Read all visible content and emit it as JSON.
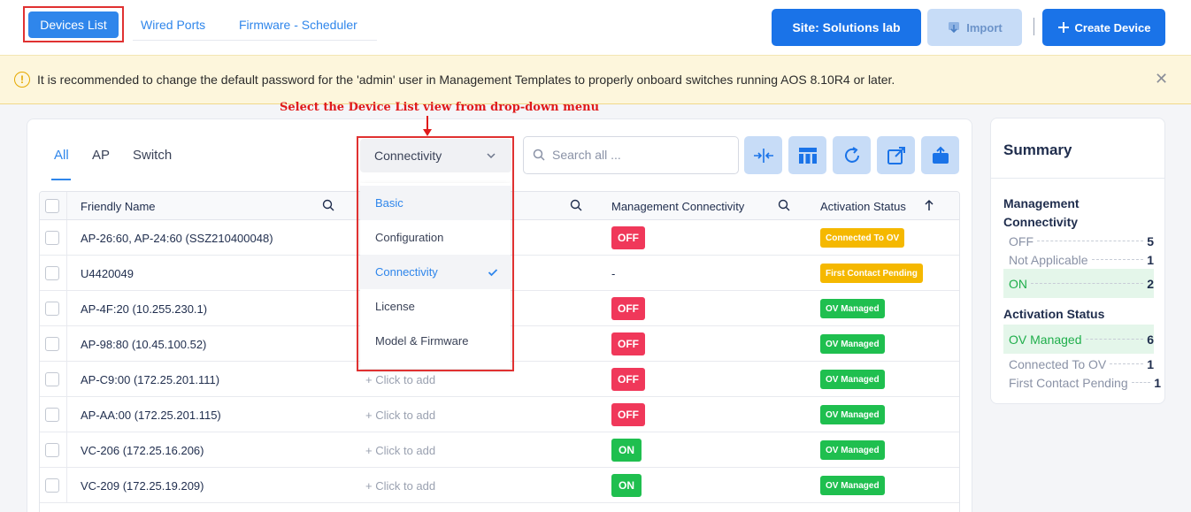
{
  "top_tabs": {
    "devices_list": "Devices List",
    "wired_ports": "Wired Ports",
    "firmware_scheduler": "Firmware - Scheduler"
  },
  "header_buttons": {
    "site": "Site:  Solutions lab",
    "import": "Import",
    "separator": "|",
    "create_device": "Create Device"
  },
  "banner": {
    "icon": "warning-circle-icon",
    "text": "It is recommended to change the default password for the 'admin' user in Management Templates to properly onboard switches running AOS 8.10R4 or later."
  },
  "annotation": "Select the Device List view from drop-down menu",
  "filter_tabs": [
    "All",
    "AP",
    "Switch"
  ],
  "view_select": {
    "selected": "Connectivity",
    "options": [
      "Basic",
      "Configuration",
      "Connectivity",
      "License",
      "Model & Firmware"
    ]
  },
  "search": {
    "placeholder": "Search all ..."
  },
  "table": {
    "headers": {
      "friendly_name": "Friendly Name",
      "management_connectivity": "Management Connectivity",
      "activation_status": "Activation Status"
    },
    "rows": [
      {
        "name": "AP-26:60, AP-24:60 (SSZ210400048)",
        "col2": "",
        "mgmt": "OFF",
        "activation": "Connected To OV"
      },
      {
        "name": "U4420049",
        "col2": "",
        "mgmt": "-",
        "activation": "First Contact Pending"
      },
      {
        "name": "AP-4F:20 (10.255.230.1)",
        "col2": "",
        "mgmt": "OFF",
        "activation": "OV Managed"
      },
      {
        "name": "AP-98:80 (10.45.100.52)",
        "col2": "",
        "mgmt": "OFF",
        "activation": "OV Managed"
      },
      {
        "name": "AP-C9:00 (172.25.201.111)",
        "col2": "+  Click to add",
        "mgmt": "OFF",
        "activation": "OV Managed"
      },
      {
        "name": "AP-AA:00 (172.25.201.115)",
        "col2": "+  Click to add",
        "mgmt": "OFF",
        "activation": "OV Managed"
      },
      {
        "name": "VC-206 (172.25.16.206)",
        "col2": "+  Click to add",
        "mgmt": "ON",
        "activation": "OV Managed"
      },
      {
        "name": "VC-209 (172.25.19.209)",
        "col2": "+  Click to add",
        "mgmt": "ON",
        "activation": "OV Managed"
      }
    ]
  },
  "summary": {
    "title": "Summary",
    "mgmt_heading_line1": "Management",
    "mgmt_heading_line2": "Connectivity",
    "mgmt": [
      {
        "label": "OFF",
        "count": "5"
      },
      {
        "label": "Not Applicable",
        "count": "1"
      },
      {
        "label": "ON",
        "count": "2"
      }
    ],
    "activation_heading": "Activation Status",
    "activation": [
      {
        "label": "OV Managed",
        "count": "6"
      },
      {
        "label": "Connected To OV",
        "count": "1"
      },
      {
        "label": "First Contact Pending",
        "count": "1"
      }
    ]
  },
  "colors": {
    "primary": "#1a73e8",
    "off_badge": "#f0385a",
    "on_badge": "#1fbf4f",
    "pending_badge": "#f5b800",
    "annotation_red": "#e01b1b"
  }
}
